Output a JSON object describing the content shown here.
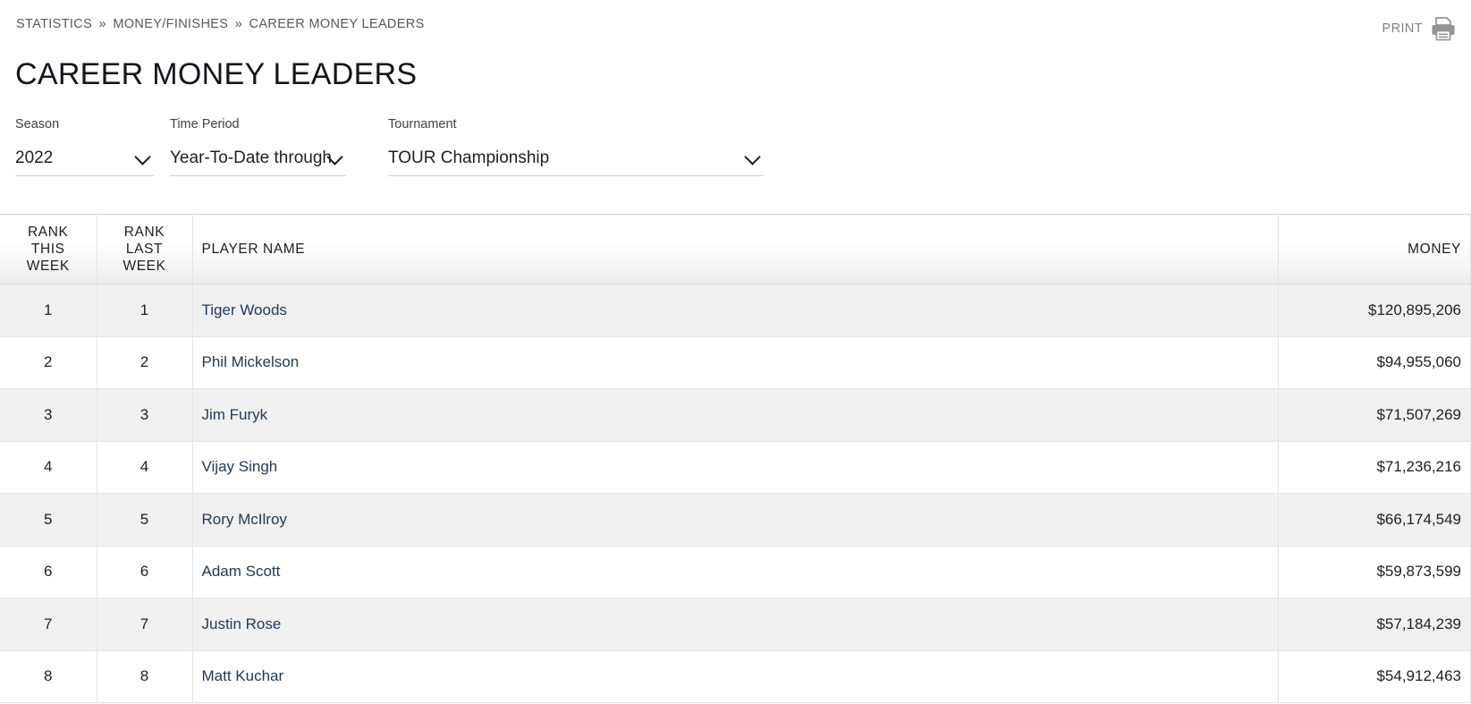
{
  "breadcrumb": {
    "items": [
      "STATISTICS",
      "MONEY/FINISHES",
      "CAREER MONEY LEADERS"
    ],
    "separator": "»"
  },
  "print": {
    "label": "PRINT",
    "icon": "printer-icon"
  },
  "page_title": "CAREER MONEY LEADERS",
  "filters": [
    {
      "label": "Season",
      "value": "2022",
      "icon": "chevron-down-icon"
    },
    {
      "label": "Time Period",
      "value": "Year-To-Date through",
      "icon": "chevron-down-icon"
    },
    {
      "label": "Tournament",
      "value": "TOUR Championship",
      "icon": "chevron-down-icon"
    }
  ],
  "table": {
    "headers": {
      "rank_this_week": "RANK THIS WEEK",
      "rank_last_week": "RANK LAST WEEK",
      "player_name": "PLAYER NAME",
      "money": "MONEY"
    },
    "rows": [
      {
        "rank_this_week": "1",
        "rank_last_week": "1",
        "player_name": "Tiger Woods",
        "money": "$120,895,206"
      },
      {
        "rank_this_week": "2",
        "rank_last_week": "2",
        "player_name": "Phil Mickelson",
        "money": "$94,955,060"
      },
      {
        "rank_this_week": "3",
        "rank_last_week": "3",
        "player_name": "Jim Furyk",
        "money": "$71,507,269"
      },
      {
        "rank_this_week": "4",
        "rank_last_week": "4",
        "player_name": "Vijay Singh",
        "money": "$71,236,216"
      },
      {
        "rank_this_week": "5",
        "rank_last_week": "5",
        "player_name": "Rory McIlroy",
        "money": "$66,174,549"
      },
      {
        "rank_this_week": "6",
        "rank_last_week": "6",
        "player_name": "Adam Scott",
        "money": "$59,873,599"
      },
      {
        "rank_this_week": "7",
        "rank_last_week": "7",
        "player_name": "Justin Rose",
        "money": "$57,184,239"
      },
      {
        "rank_this_week": "8",
        "rank_last_week": "8",
        "player_name": "Matt Kuchar",
        "money": "$54,912,463"
      }
    ]
  },
  "colors": {
    "link": "#23395b",
    "text": "#1d1f23",
    "muted": "#58595b",
    "row_alt": "#f1f1f2",
    "border": "#e4e5e6"
  }
}
